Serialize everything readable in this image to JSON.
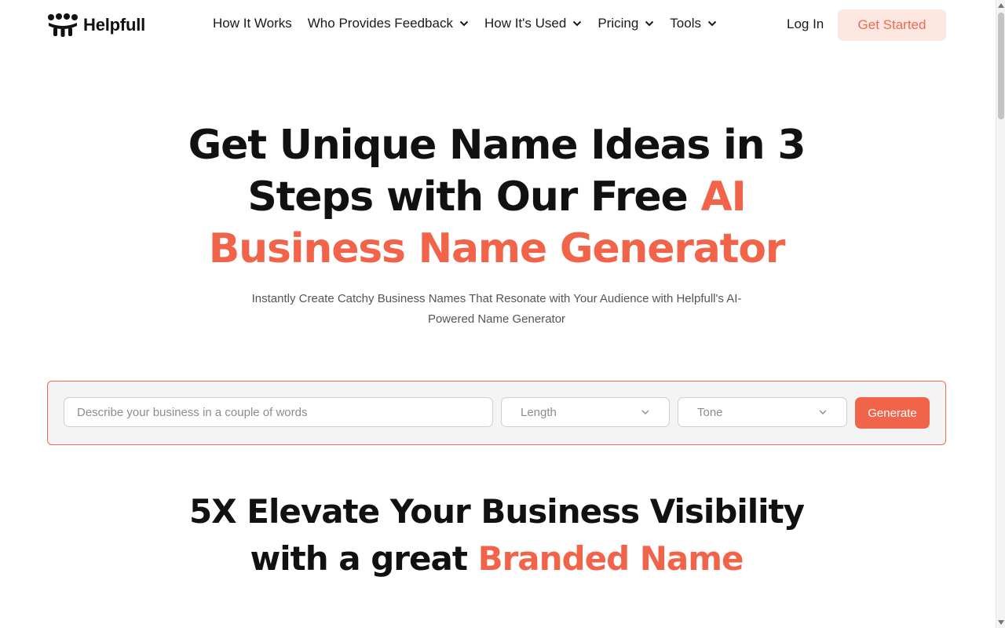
{
  "brand": {
    "name": "Helpfull",
    "accent": "#f26449"
  },
  "nav": {
    "items": [
      {
        "label": "How It Works",
        "has_dropdown": false
      },
      {
        "label": "Who Provides Feedback",
        "has_dropdown": true
      },
      {
        "label": "How It's Used",
        "has_dropdown": true
      },
      {
        "label": "Pricing",
        "has_dropdown": true
      },
      {
        "label": "Tools",
        "has_dropdown": true
      }
    ],
    "login": "Log In",
    "cta": "Get Started"
  },
  "hero": {
    "title_line1": "Get Unique Name Ideas in 3",
    "title_line2_plain": "Steps with Our Free ",
    "title_line2_accent": "AI",
    "title_line3_accent": "Business Name Generator",
    "subtitle": "Instantly Create Catchy Business Names That Resonate with Your Audience with Helpfull's AI-Powered Name Generator"
  },
  "generator": {
    "description_placeholder": "Describe your business in a couple of words",
    "length_label": "Length",
    "tone_label": "Tone",
    "button": "Generate"
  },
  "section": {
    "title_line1": "5X Elevate Your Business Visibility",
    "title_line2_plain": "with a great ",
    "title_line2_accent": "Branded Name"
  }
}
